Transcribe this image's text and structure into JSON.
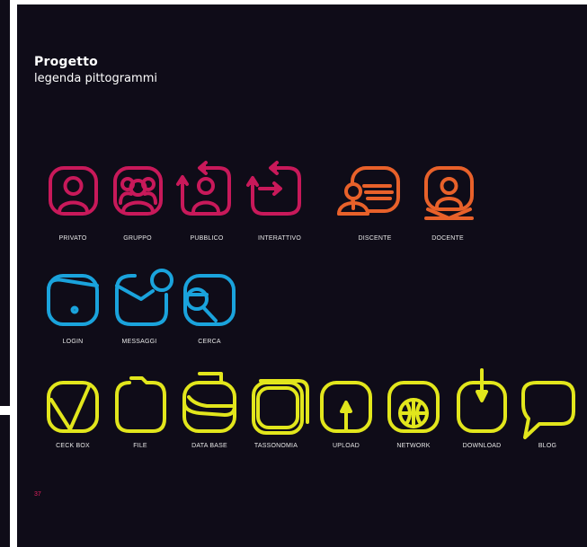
{
  "document": {
    "title": "Progetto",
    "subtitle": "legenda pittogrammi",
    "page_number": "37"
  },
  "colors": {
    "background": "#0f0c18",
    "magenta": "#c8195a",
    "orange": "#e8612a",
    "blue": "#1aa3dc",
    "yellow": "#e2e61c"
  },
  "rows": [
    {
      "color": "magenta",
      "icons": [
        {
          "icon": "user-icon",
          "label": "PRIVATO"
        },
        {
          "icon": "group-icon",
          "label": "GRUPPO"
        },
        {
          "icon": "public-user-icon",
          "label": "PUBBLICO"
        },
        {
          "icon": "interactive-icon",
          "label": "INTERATTIVO"
        }
      ]
    },
    {
      "color": "orange",
      "icons": [
        {
          "icon": "learner-icon",
          "label": "DISCENTE"
        },
        {
          "icon": "teacher-icon",
          "label": "DOCENTE"
        }
      ]
    },
    {
      "color": "blue",
      "icons": [
        {
          "icon": "login-icon",
          "label": "LOGIN"
        },
        {
          "icon": "message-icon",
          "label": "MESSAGGI"
        },
        {
          "icon": "search-icon",
          "label": "CERCA"
        }
      ]
    },
    {
      "color": "yellow",
      "icons": [
        {
          "icon": "checkbox-icon",
          "label": "CECK BOX"
        },
        {
          "icon": "file-icon",
          "label": "FILE"
        },
        {
          "icon": "database-icon",
          "label": "DATA BASE"
        },
        {
          "icon": "taxonomy-icon",
          "label": "TASSONOMIA"
        },
        {
          "icon": "upload-icon",
          "label": "UPLOAD"
        },
        {
          "icon": "network-icon",
          "label": "NETWORK"
        },
        {
          "icon": "download-icon",
          "label": "DOWNLOAD"
        },
        {
          "icon": "blog-icon",
          "label": "BLOG"
        }
      ]
    }
  ]
}
